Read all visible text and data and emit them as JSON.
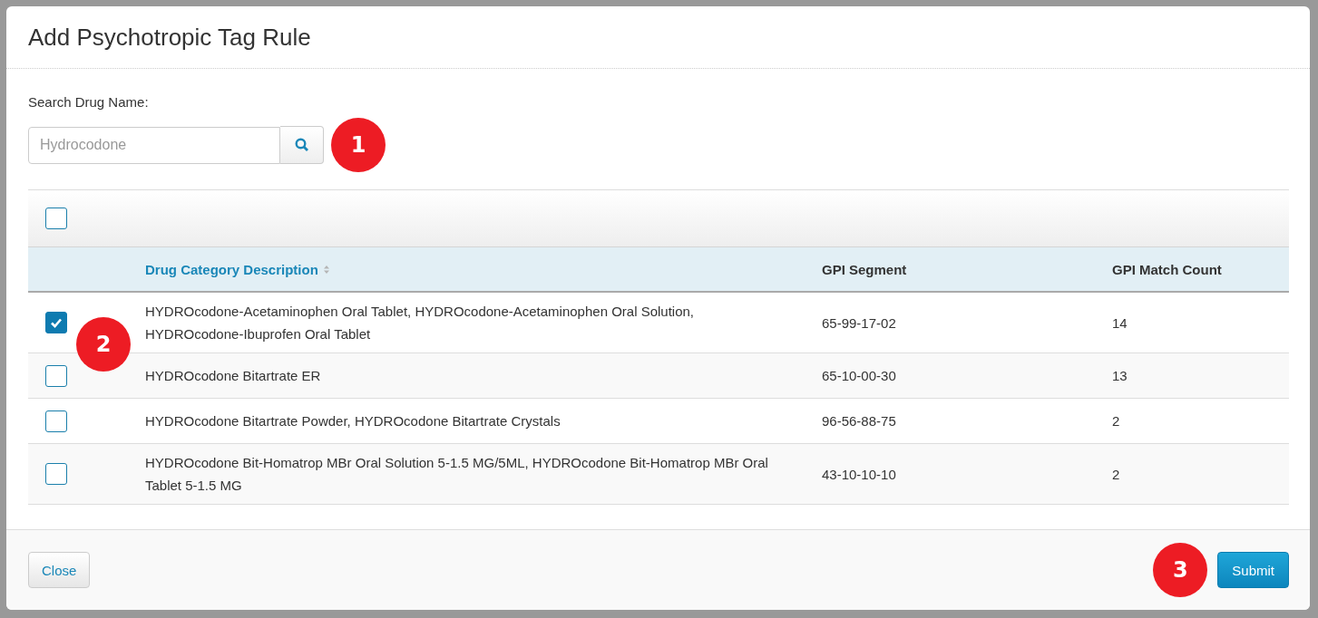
{
  "dialog": {
    "title": "Add Psychotropic Tag Rule"
  },
  "search": {
    "label": "Search Drug Name:",
    "placeholder": "Hydrocodone"
  },
  "table": {
    "select_all_checked": false,
    "columns": [
      {
        "label": "Drug Category Description",
        "sortable": true
      },
      {
        "label": "GPI Segment",
        "sortable": false
      },
      {
        "label": "GPI Match Count",
        "sortable": false
      }
    ],
    "rows": [
      {
        "checked": true,
        "cells": [
          "HYDROcodone-Acetaminophen Oral Tablet, HYDROcodone-Acetaminophen Oral Solution, HYDROcodone-Ibuprofen Oral Tablet",
          "65-99-17-02",
          "14"
        ]
      },
      {
        "checked": false,
        "cells": [
          "HYDROcodone Bitartrate ER",
          "65-10-00-30",
          "13"
        ]
      },
      {
        "checked": false,
        "cells": [
          "HYDROcodone Bitartrate Powder, HYDROcodone Bitartrate Crystals",
          "96-56-88-75",
          "2"
        ]
      },
      {
        "checked": false,
        "cells": [
          "HYDROcodone Bit-Homatrop MBr Oral Solution 5-1.5 MG/5ML, HYDROcodone Bit-Homatrop MBr Oral Tablet 5-1.5 MG",
          "43-10-10-10",
          "2"
        ]
      }
    ]
  },
  "footer": {
    "close": "Close",
    "submit": "Submit"
  },
  "callouts": [
    {
      "kind": "search",
      "text": "1"
    },
    {
      "kind": "row",
      "text": "2"
    },
    {
      "kind": "submit",
      "text": "3"
    }
  ]
}
